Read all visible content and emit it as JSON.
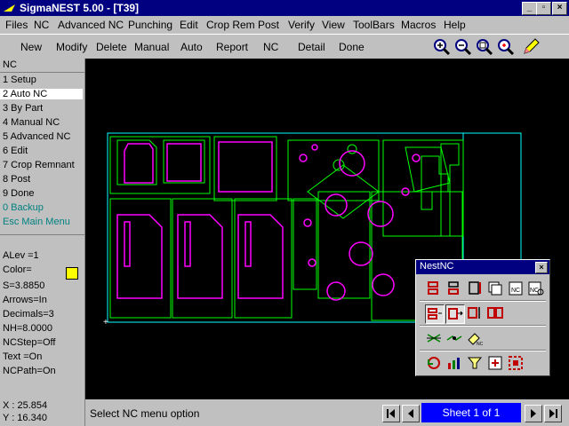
{
  "window": {
    "title": "SigmaNEST 5.00 - [T39]",
    "controls": [
      "_",
      "▫",
      "×"
    ]
  },
  "menubar": {
    "items": [
      "Files",
      "NC",
      "Advanced NC",
      "Punching",
      "Edit",
      "Crop Rem",
      "Post",
      "Verify",
      "View",
      "ToolBars",
      "Macros",
      "Help"
    ]
  },
  "toolbar": {
    "buttons": [
      "New",
      "Modify",
      "Delete",
      "Manual",
      "Auto",
      "Report",
      "NC",
      "Detail",
      "Done"
    ],
    "zoom_icons": [
      "zoom-in-icon",
      "zoom-out-icon",
      "zoom-fit-icon",
      "zoom-window-icon",
      "edit-pencil-icon"
    ]
  },
  "leftpanel": {
    "header": "NC",
    "menu": [
      "1 Setup",
      "2 Auto NC",
      "3 By Part",
      "4 Manual NC",
      "5 Advanced NC",
      "6 Edit",
      "7 Crop Remnant",
      "8 Post",
      "9 Done",
      "0 Backup",
      "Esc Main Menu"
    ],
    "selected_index": 1,
    "info": [
      "ALev =1",
      "Color=",
      "S=3.8850",
      "Arrows=In",
      "Decimals=3",
      "NH=8.0000",
      "NCStep=Off",
      "Text  =On",
      "NCPath=On"
    ],
    "color_swatch": "#ffff00"
  },
  "status": {
    "message": "Select NC menu option",
    "x": "X : 25.854",
    "y": "Y : 16.340",
    "sheet": "Sheet 1 of 1"
  },
  "palette": {
    "title": "NestNC",
    "close": "×"
  },
  "colors": {
    "titlebar": "#000080",
    "part_outline": "#00ff00",
    "hole": "#ff00ff",
    "sheet_border": "#00ffff",
    "canvas": "#000000"
  }
}
